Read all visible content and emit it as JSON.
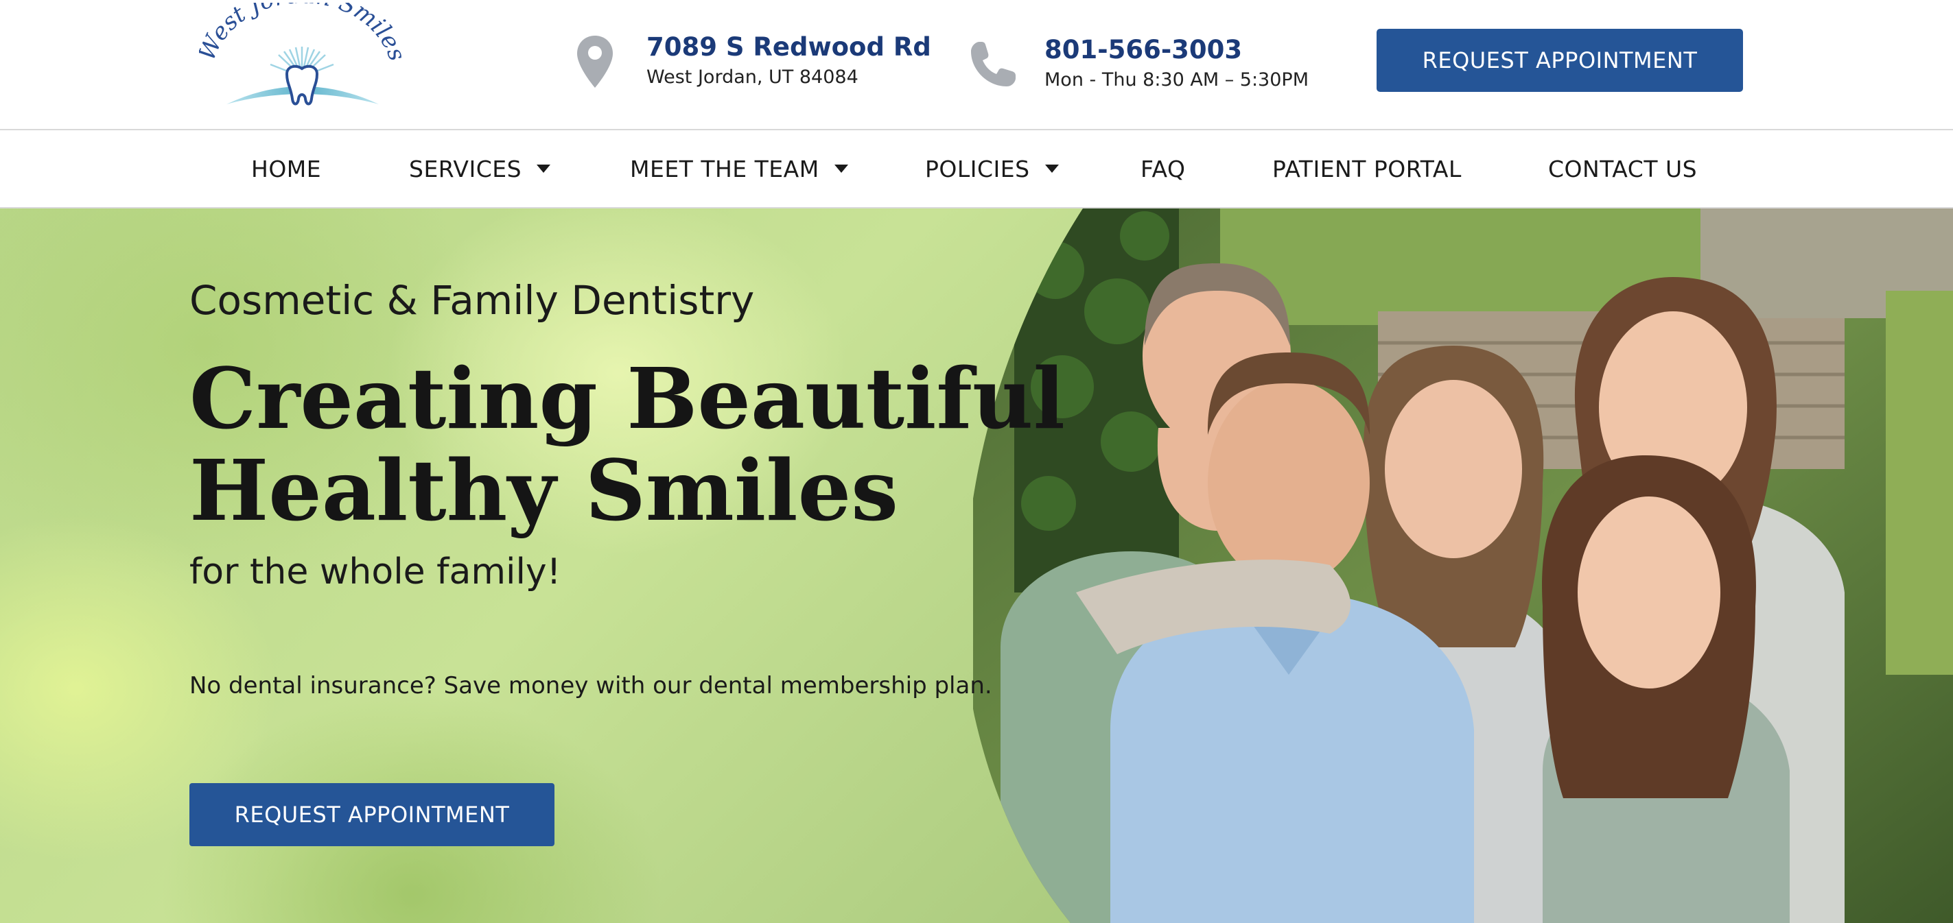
{
  "brand": {
    "logo_text": "West Jordan Smiles",
    "colors": {
      "primary": "#255597",
      "heading_blue": "#1b3a78",
      "logo_arc": "#7cc3d6"
    }
  },
  "header": {
    "address": {
      "icon": "map-pin-icon",
      "line1": "7089 S Redwood Rd",
      "line2": "West Jordan, UT 84084"
    },
    "phone": {
      "icon": "phone-icon",
      "number": "801-566-3003",
      "hours": "Mon - Thu 8:30 AM – 5:30PM"
    },
    "cta_label": "REQUEST APPOINTMENT"
  },
  "nav": {
    "items": [
      {
        "label": "HOME",
        "has_dropdown": false
      },
      {
        "label": "SERVICES",
        "has_dropdown": true
      },
      {
        "label": "MEET THE TEAM",
        "has_dropdown": true
      },
      {
        "label": "POLICIES",
        "has_dropdown": true
      },
      {
        "label": "FAQ",
        "has_dropdown": false
      },
      {
        "label": "PATIENT PORTAL",
        "has_dropdown": false
      },
      {
        "label": "CONTACT US",
        "has_dropdown": false
      }
    ]
  },
  "hero": {
    "eyebrow": "Cosmetic & Family Dentistry",
    "headline_line1": "Creating Beautiful",
    "headline_line2": "Healthy Smiles",
    "tagline": "for the whole family!",
    "insurance_text": "No dental insurance? Save money with our dental membership plan.",
    "cta_label": "REQUEST APPOINTMENT"
  }
}
